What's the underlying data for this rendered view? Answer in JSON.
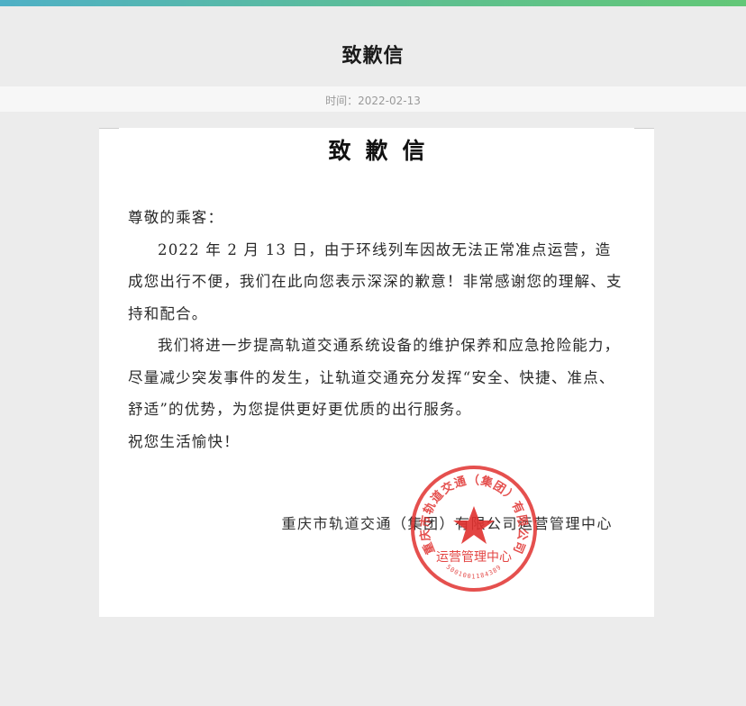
{
  "page": {
    "title": "致歉信",
    "date": "时间：2022-02-13"
  },
  "letter": {
    "heading": "致歉信",
    "salutation": "尊敬的乘客：",
    "paragraphs": [
      "2022 年 2 月 13 日，由于环线列车因故无法正常准点运营，造成您出行不便，我们在此向您表示深深的歉意！非常感谢您的理解、支持和配合。",
      "我们将进一步提高轨道交通系统设备的维护保养和应急抢险能力，尽量减少突发事件的发生，让轨道交通充分发挥“安全、快捷、准点、舒适”的优势，为您提供更好更优质的出行服务。",
      "祝您生活愉快！"
    ],
    "signature": "重庆市轨道交通（集团）有限公司运营管理中心",
    "seal": {
      "ring_text": "重庆市轨道交通（集团）有限公司",
      "center_text": "运营管理中心",
      "code": "5001001184389",
      "color": "#e0312f"
    }
  },
  "colors": {
    "accent_gradient_start": "#4fb0c6",
    "accent_gradient_end": "#63c777"
  }
}
